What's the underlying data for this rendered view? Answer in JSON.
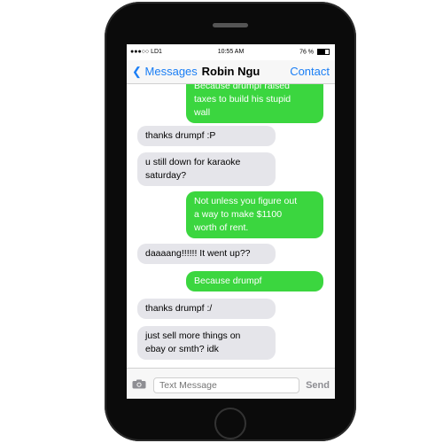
{
  "status": {
    "carrier": "●●●○○ LD1 ",
    "time": "10:55 AM",
    "battery": "76 %"
  },
  "nav": {
    "back": "Messages",
    "title": "Robin Ngu",
    "contact": "Contact"
  },
  "messages": [
    {
      "from": "me",
      "text": "Because drumpf raised\ntaxes to build his stupid\nwall"
    },
    {
      "from": "them",
      "text": "thanks drumpf :P"
    },
    {
      "from": "them",
      "text": "u still down for karaoke\nsaturday?"
    },
    {
      "from": "me",
      "text": "Not unless you figure out\na way to make $1100\nworth of rent."
    },
    {
      "from": "them",
      "text": "daaaang!!!!!! It went up??"
    },
    {
      "from": "me",
      "text": "Because drumpf"
    },
    {
      "from": "them",
      "text": "thanks drumpf :/"
    },
    {
      "from": "them",
      "text": "just sell more things on\nebay or smth? idk"
    }
  ],
  "input": {
    "placeholder": "Text Message",
    "send": "Send"
  },
  "colors": {
    "accent": "#1a7ef5",
    "sent_bubble": "#3bd63f",
    "received_bubble": "#e5e5ea"
  },
  "icons": {
    "back": "chevron-left-icon",
    "camera": "camera-icon",
    "wifi": "wifi-icon",
    "battery": "battery-icon"
  }
}
